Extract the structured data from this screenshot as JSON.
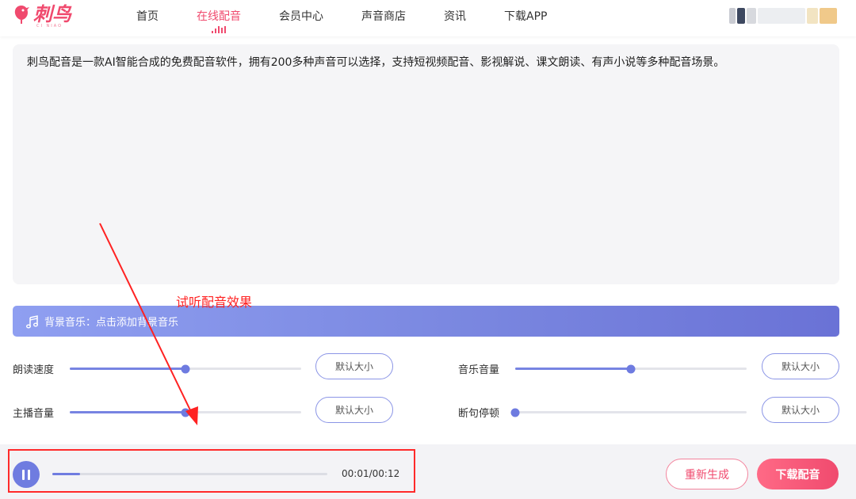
{
  "header": {
    "logo_text": "刺鸟",
    "logo_sub": "CI NIAO",
    "nav": [
      {
        "label": "首页"
      },
      {
        "label": "在线配音"
      },
      {
        "label": "会员中心"
      },
      {
        "label": "声音商店"
      },
      {
        "label": "资讯"
      },
      {
        "label": "下载APP"
      }
    ],
    "active_nav": "在线配音"
  },
  "editor": {
    "text": "刺鸟配音是一款AI智能合成的免费配音软件，拥有200多种声音可以选择，支持短视频配音、影视解说、课文朗读、有声小说等多种配音场景。"
  },
  "annotation": {
    "label": "试听配音效果"
  },
  "bgm": {
    "label": "背景音乐：点击添加背景音乐",
    "icon": "music-note-icon"
  },
  "sliders": [
    {
      "label": "朗读速度",
      "value": 0.5,
      "button": "默认大小"
    },
    {
      "label": "音乐音量",
      "value": 0.5,
      "button": "默认大小"
    },
    {
      "label": "主播音量",
      "value": 0.5,
      "button": "默认大小"
    },
    {
      "label": "断句停顿",
      "value": 0.0,
      "button": "默认大小"
    }
  ],
  "player": {
    "time": "00:01/00:12",
    "progress": 0.1,
    "state": "playing"
  },
  "actions": {
    "regenerate": "重新生成",
    "download": "下载配音"
  },
  "colors": {
    "brand": "#f04a6e",
    "accent": "#6f7ce0",
    "annotation": "#ff2222"
  }
}
